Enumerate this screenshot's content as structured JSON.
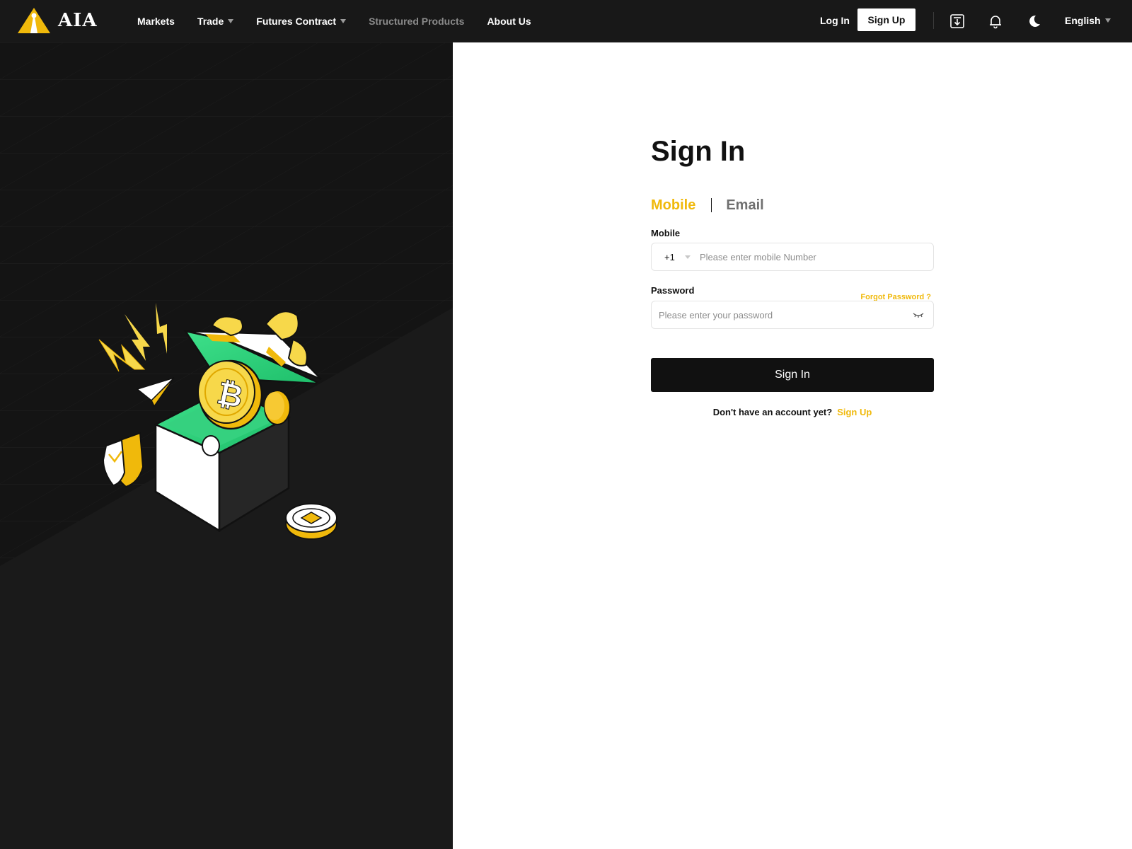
{
  "brand": {
    "name": "AIA"
  },
  "nav": {
    "markets": "Markets",
    "trade": "Trade",
    "futures": "Futures Contract",
    "structured": "Structured Products",
    "about": "About Us"
  },
  "header": {
    "login": "Log In",
    "signup": "Sign Up",
    "language": "English",
    "icons": [
      "download-icon",
      "bell-icon",
      "moon-icon"
    ]
  },
  "signin": {
    "title": "Sign In",
    "tabs": [
      {
        "label": "Mobile",
        "active": true
      },
      {
        "label": "Email",
        "active": false
      }
    ],
    "mobile_label": "Mobile",
    "country_code": "+1",
    "mobile_placeholder": "Please enter mobile Number",
    "password_label": "Password",
    "forgot": "Forgot Password ?",
    "password_placeholder": "Please enter your password",
    "submit": "Sign In",
    "no_account": "Don't have an account yet?",
    "signup_link": "Sign Up"
  },
  "colors": {
    "accent": "#f0b90b",
    "dark": "#181818",
    "green": "#3ee08a"
  }
}
